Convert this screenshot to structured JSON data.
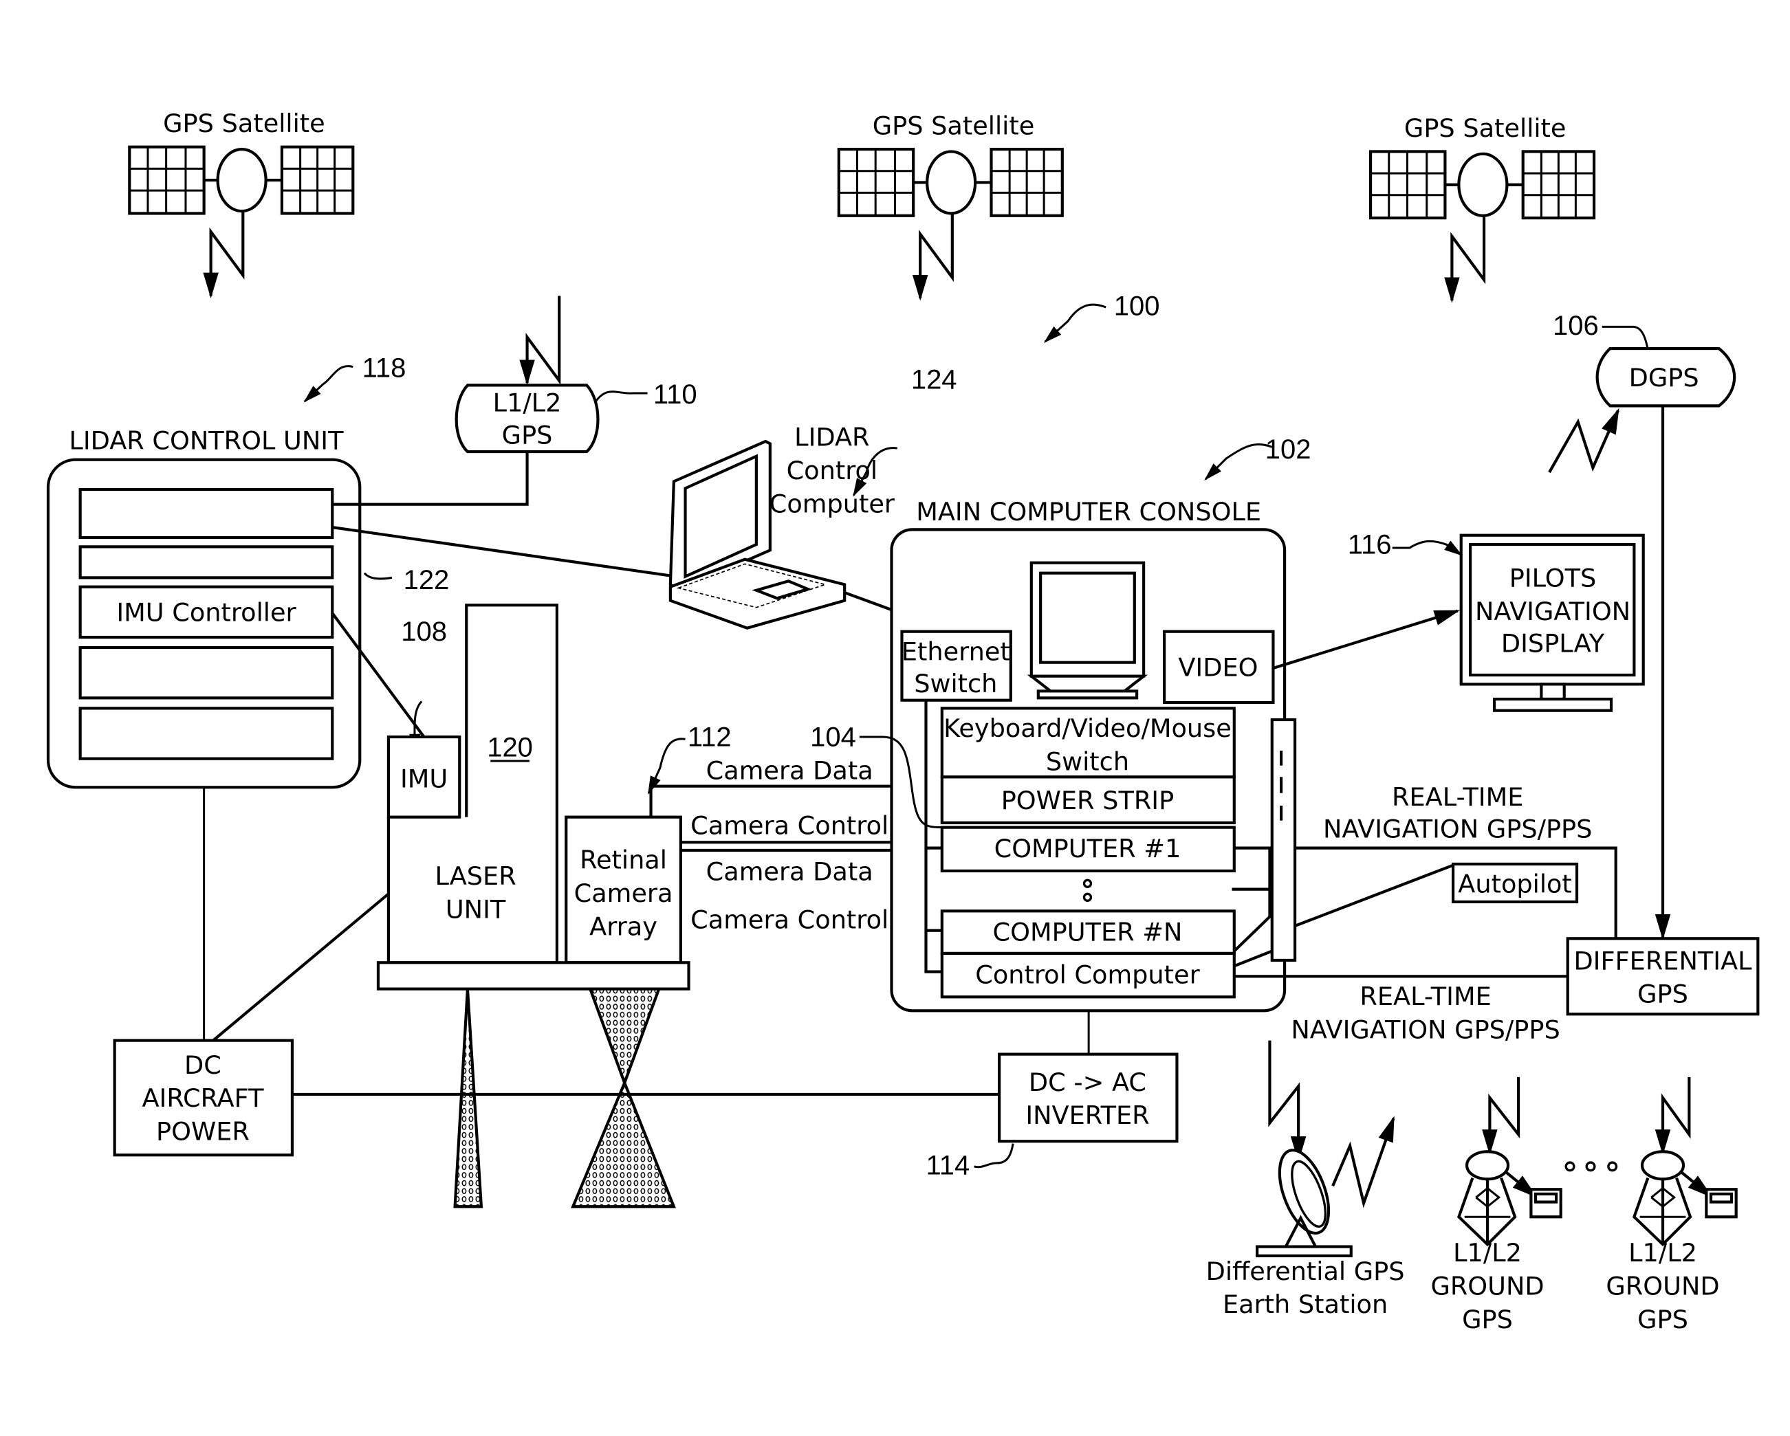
{
  "figure": {
    "reference_system": "100",
    "satellites": [
      {
        "label": "GPS Satellite"
      },
      {
        "label": "GPS Satellite"
      },
      {
        "label": "GPS Satellite"
      }
    ],
    "lidar_control_unit": {
      "title": "LIDAR CONTROL UNIT",
      "ref": "118",
      "rack_ref": "122",
      "slots": [
        "",
        "",
        "IMU Controller",
        "",
        ""
      ]
    },
    "l1l2_gps": {
      "line1": "L1/L2",
      "line2": "GPS",
      "ref": "110"
    },
    "lidar_control_computer": {
      "line1": "LIDAR",
      "line2": "Control",
      "line3": "Computer",
      "ref": "124"
    },
    "main_console": {
      "title": "MAIN COMPUTER CONSOLE",
      "ref": "102",
      "ethernet_switch": {
        "line1": "Ethernet",
        "line2": "Switch"
      },
      "video": "VIDEO",
      "kvm_switch": {
        "line1": "Keyboard/Video/Mouse",
        "line2": "Switch"
      },
      "power_strip": "POWER STRIP",
      "computer_1": "COMPUTER #1",
      "computer_n": "COMPUTER #N",
      "control_computer": "Control Computer",
      "bus_ref": "104"
    },
    "dgps": {
      "label": "DGPS",
      "ref": "106"
    },
    "pilots_display": {
      "line1": "PILOTS",
      "line2": "NAVIGATION",
      "line3": "DISPLAY",
      "ref": "116"
    },
    "imu": {
      "label": "IMU",
      "ref": "108"
    },
    "laser_unit": {
      "line1": "LASER",
      "line2": "UNIT",
      "ref": "120"
    },
    "camera_array": {
      "line1": "Retinal",
      "line2": "Camera",
      "line3": "Array",
      "ref": "112"
    },
    "camera_links": [
      "Camera Data",
      "Camera Control",
      "Camera Data",
      "Camera Control"
    ],
    "autopilot": "Autopilot",
    "realtime_nav_upper": {
      "line1": "REAL-TIME",
      "line2": "NAVIGATION GPS/PPS"
    },
    "realtime_nav_lower": {
      "line1": "REAL-TIME",
      "line2": "NAVIGATION GPS/PPS"
    },
    "differential_gps": {
      "line1": "DIFFERENTIAL",
      "line2": "GPS"
    },
    "dc_power": {
      "line1": "DC",
      "line2": "AIRCRAFT",
      "line3": "POWER"
    },
    "inverter": {
      "line1": "DC -> AC",
      "line2": "INVERTER",
      "ref": "114"
    },
    "earth_station": {
      "line1": "Differential GPS",
      "line2": "Earth Station"
    },
    "ground_gps": [
      {
        "line1": "L1/L2",
        "line2": "GROUND",
        "line3": "GPS"
      },
      {
        "line1": "L1/L2",
        "line2": "GROUND",
        "line3": "GPS"
      }
    ]
  }
}
